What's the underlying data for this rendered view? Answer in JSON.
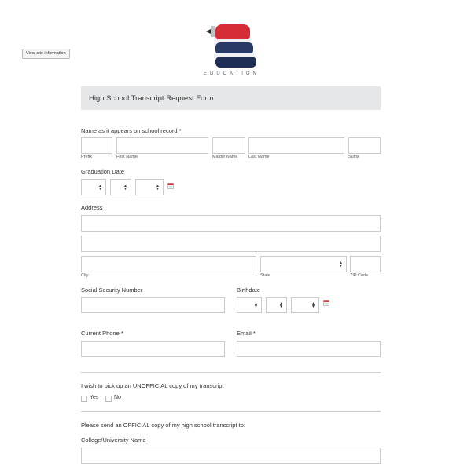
{
  "site_info_button": "View site information",
  "logo": {
    "text": "EDUCATION",
    "colors": {
      "red": "#d62c35",
      "navy": "#1f2e55",
      "grey": "#8a8f99"
    }
  },
  "form": {
    "title": "High School Transcript Request Form",
    "name": {
      "label": "Name as it appears on school record *",
      "sublabels": {
        "prefix": "Prefix",
        "first": "First Name",
        "middle": "Middle Name",
        "last": "Last Name",
        "suffix": "Suffix"
      }
    },
    "graduation": {
      "label": "Graduation Date"
    },
    "address": {
      "label": "Address",
      "sublabels": {
        "city": "City",
        "state": "State",
        "zip": "ZIP Code"
      }
    },
    "ssn": {
      "label": "Social Security Number"
    },
    "birthdate": {
      "label": "Birthdate"
    },
    "phone": {
      "label": "Current Phone *"
    },
    "email": {
      "label": "Email *"
    },
    "unofficial": {
      "label": "I wish to pick up an UNOFFICIAL copy of my transcript",
      "options": [
        "Yes",
        "No"
      ]
    },
    "official": {
      "label": "Please send an OFFICIAL copy of my high school transcript to:"
    },
    "college": {
      "label": "College/University Name"
    }
  },
  "icons": {
    "calendar": "calendar-icon",
    "select_arrows": "updown-arrows-icon"
  }
}
